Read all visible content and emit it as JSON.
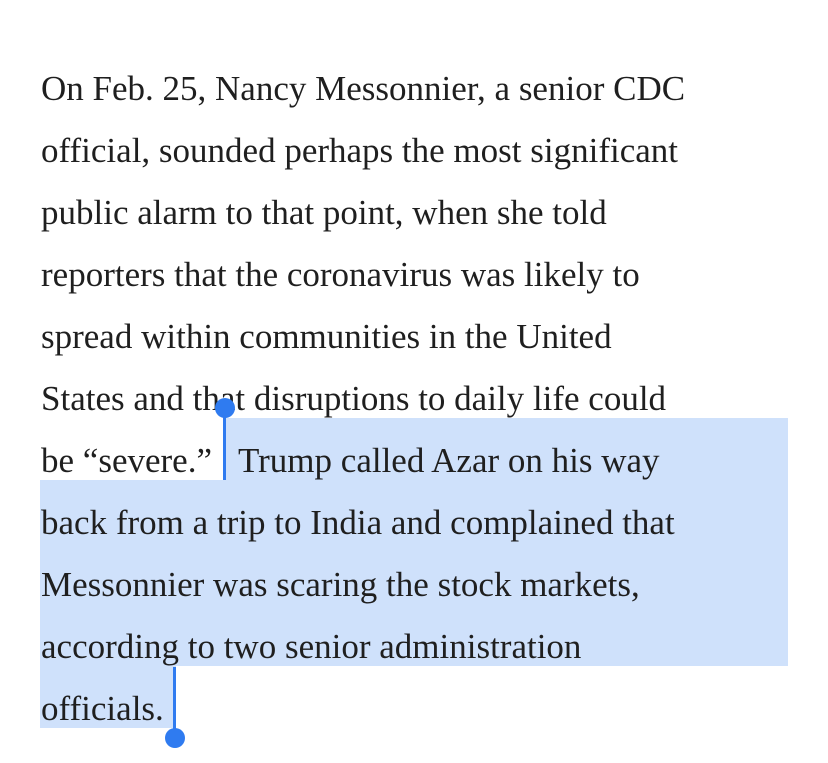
{
  "article": {
    "lines": [
      "On Feb. 25, Nancy Messonnier, a senior CDC",
      "official, sounded perhaps the most significant",
      "public alarm to that point, when she told",
      "reporters that the coronavirus was likely to",
      "spread within communities in the United",
      "States and that disruptions to daily life could",
      "be “severe.”",
      "Trump called Azar on his way",
      "back from a trip to India and complained that",
      "Messonnier was scaring the stock markets,",
      "according to two senior administration",
      "officials."
    ]
  },
  "selection": {
    "highlight_color": "#cfe1fb",
    "handle_color": "#2f7bf0",
    "selected_text": "Trump called Azar on his way back from a trip to India and complained that Messonnier was scaring the stock markets, according to two senior administration officials."
  }
}
